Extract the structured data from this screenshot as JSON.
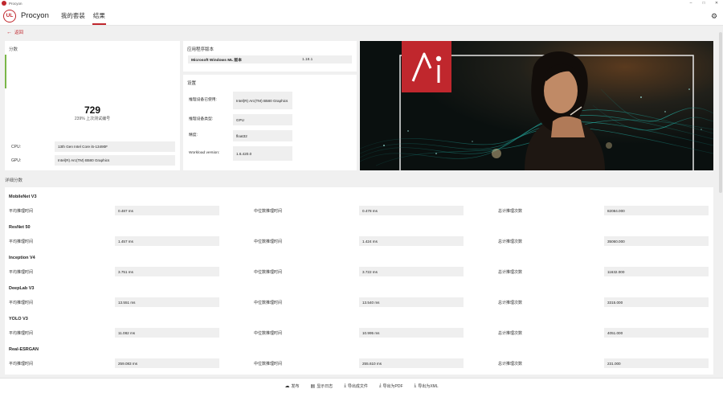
{
  "window": {
    "title": "Procyon"
  },
  "header": {
    "brand": "Procyon",
    "logo_text": "UL",
    "tabs": [
      {
        "label": "我的套装",
        "active": false
      },
      {
        "label": "结果",
        "active": true
      }
    ]
  },
  "back": {
    "label": "返回"
  },
  "score": {
    "label": "分数",
    "value": "729",
    "subtitle": "239% 上次测试编号",
    "accent_color": "#7ab648",
    "cpu_label": "CPU:",
    "cpu_value": "13th Gen Intel Core i5-13490F",
    "gpu_label": "GPU:",
    "gpu_value": "Intel(R) Arc(TM) B580 Graphics"
  },
  "version": {
    "title": "应用程序版本",
    "key": "Microsoft Windows ML 版本",
    "value": "1.18.1"
  },
  "settings": {
    "title": "设置",
    "rows": [
      {
        "key": "推理设备已使用:",
        "value": "Intel(R) Arc(TM) B580 Graphics"
      },
      {
        "key": "推理设备类型:",
        "value": "GPU"
      },
      {
        "key": "精度:",
        "value": "float32"
      },
      {
        "key": "Workload version:",
        "value": "1.6.420.0"
      }
    ]
  },
  "details": {
    "label": "详细分数",
    "col_avg": "平均推理时间",
    "col_median": "中位数推理时间",
    "col_total": "总计推理次数",
    "models": [
      {
        "name": "MobileNet V3",
        "avg": "0.487 ms",
        "median": "0.478 ms",
        "total": "82084.000"
      },
      {
        "name": "ResNet 50",
        "avg": "1.457 ms",
        "median": "1.424 ms",
        "total": "35060.000"
      },
      {
        "name": "Inception V4",
        "avg": "3.751 ms",
        "median": "3.722 ms",
        "total": "11632.000"
      },
      {
        "name": "DeepLab V3",
        "avg": "13.551 ms",
        "median": "13.540 ms",
        "total": "3315.000"
      },
      {
        "name": "YOLO V3",
        "avg": "11.082 ms",
        "median": "10.995 ms",
        "total": "4051.000"
      },
      {
        "name": "Real-ESRGAN",
        "avg": "259.083 ms",
        "median": "255.610 ms",
        "total": "231.000"
      }
    ]
  },
  "toolbar": {
    "buttons": [
      {
        "label": "发布",
        "icon": "cloud-upload-icon",
        "glyph": "☁"
      },
      {
        "label": "显示日志",
        "icon": "log-icon",
        "glyph": "▤"
      },
      {
        "label": "导出成文件",
        "icon": "download-icon",
        "glyph": "⤓"
      },
      {
        "label": "导出为PDF",
        "icon": "pdf-icon",
        "glyph": "⤓"
      },
      {
        "label": "导出为XML",
        "icon": "xml-icon",
        "glyph": "⤓"
      }
    ]
  },
  "colors": {
    "accent": "#c0272d",
    "score_bar": "#7ab648"
  }
}
